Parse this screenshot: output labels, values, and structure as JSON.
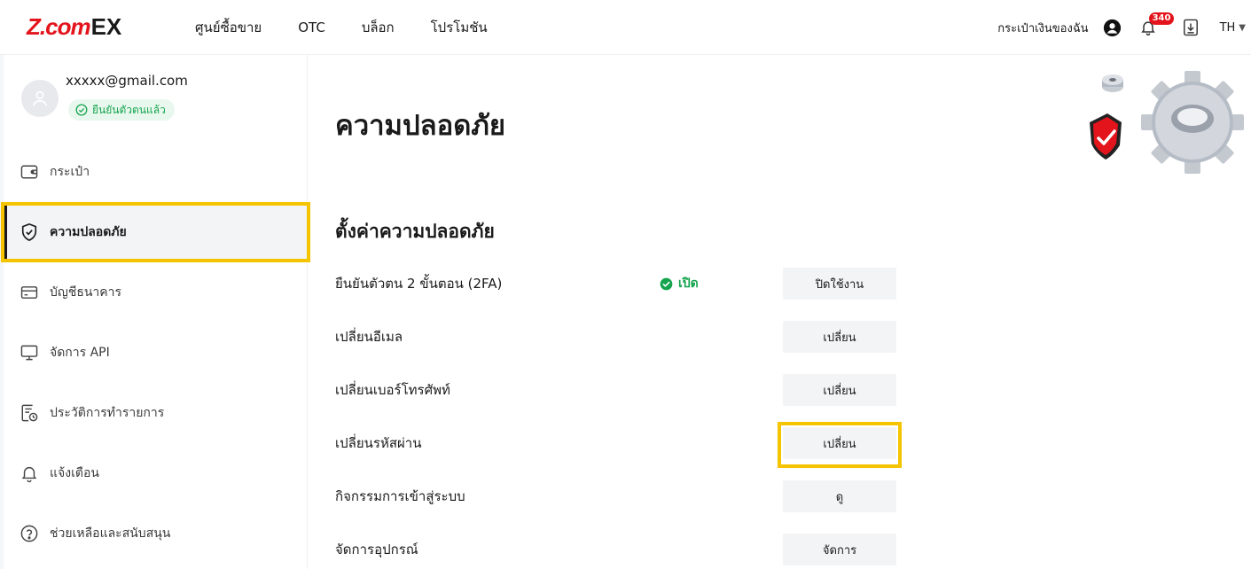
{
  "header": {
    "logo": {
      "brand": "Z.com",
      "suffix": "EX"
    },
    "nav": [
      {
        "label": "ศูนย์ซื้อขาย"
      },
      {
        "label": "OTC"
      },
      {
        "label": "บล็อก"
      },
      {
        "label": "โปรโมชัน"
      }
    ],
    "wallet_label": "กระเป๋าเงินของฉัน",
    "notification_count": "340",
    "language": "TH"
  },
  "sidebar": {
    "email": "xxxxx@gmail.com",
    "verified_label": "ยืนยันตัวตนแล้ว",
    "items": [
      {
        "label": "กระเป๋า",
        "icon": "wallet-icon"
      },
      {
        "label": "ความปลอดภัย",
        "icon": "shield-icon",
        "active": true
      },
      {
        "label": "บัญชีธนาคาร",
        "icon": "bank-card-icon"
      },
      {
        "label": "จัดการ API",
        "icon": "monitor-icon"
      },
      {
        "label": "ประวัติการทำรายการ",
        "icon": "history-icon"
      },
      {
        "label": "แจ้งเตือน",
        "icon": "bell-icon"
      },
      {
        "label": "ช่วยเหลือและสนับสนุน",
        "icon": "help-icon"
      }
    ]
  },
  "main": {
    "page_title": "ความปลอดภัย",
    "section_title": "ตั้งค่าความปลอดภัย",
    "settings": [
      {
        "label": "ยืนยันตัวตน 2 ขั้นตอน (2FA)",
        "status": "เปิด",
        "button": "ปิดใช้งาน"
      },
      {
        "label": "เปลี่ยนอีเมล",
        "status": "",
        "button": "เปลี่ยน"
      },
      {
        "label": "เปลี่ยนเบอร์โทรศัพท์",
        "status": "",
        "button": "เปลี่ยน"
      },
      {
        "label": "เปลี่ยนรหัสผ่าน",
        "status": "",
        "button": "เปลี่ยน"
      },
      {
        "label": "กิจกรรมการเข้าสู่ระบบ",
        "status": "",
        "button": "ดู"
      },
      {
        "label": "จัดการอุปกรณ์",
        "status": "",
        "button": "จัดการ"
      }
    ]
  },
  "colors": {
    "brand_red": "#e3141b",
    "success_green": "#14a44d",
    "highlight_yellow": "#f5c400",
    "button_bg": "#f3f4f6"
  }
}
